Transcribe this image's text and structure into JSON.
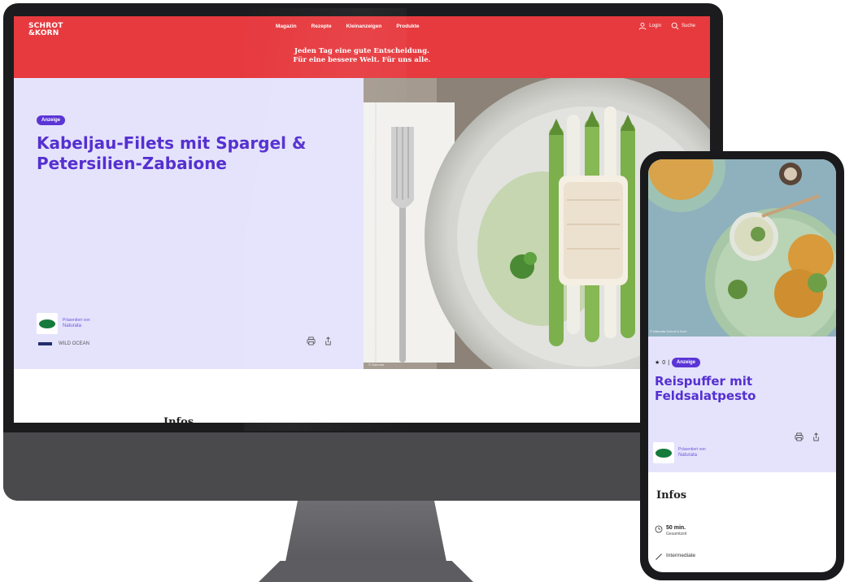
{
  "desktop": {
    "logo": {
      "line1": "SCHROT",
      "line2": "&KORN"
    },
    "nav": [
      "Magazin",
      "Rezepte",
      "Kleinanzeigen",
      "Produkte"
    ],
    "tools": {
      "login": "Login",
      "search": "Suche"
    },
    "tagline": {
      "line1": "Jeden Tag eine gute Entscheidung.",
      "line2": "Für eine bessere Welt. Für uns alle."
    },
    "badge": "Anzeige",
    "title": "Kabeljau-Filets mit Spargel & Petersilien-Zabaione",
    "sponsor": {
      "prefix": "Präsentiert von",
      "name": "Naturata"
    },
    "partial_text": "WILD OCEAN",
    "photo_caption": "© Naturata",
    "infos_heading": "Infos"
  },
  "phone": {
    "photo_caption": "© Naturata Schrot & Korn",
    "rating": "0",
    "badge": "Anzeige",
    "title": "Reispuffer mit Feldsalatpesto",
    "sponsor": {
      "prefix": "Präsentiert von",
      "name": "Naturata"
    },
    "infos_heading": "Infos",
    "time": {
      "value": "50 min.",
      "label": "Gesamtzeit"
    },
    "difficulty": "Intermediate"
  },
  "colors": {
    "header_red": "#e63a3f",
    "accent_purple": "#5530d0",
    "hero_lavender": "#e5e3fc",
    "badge_purple": "#5b35d5",
    "sponsor_green": "#157a3c"
  }
}
